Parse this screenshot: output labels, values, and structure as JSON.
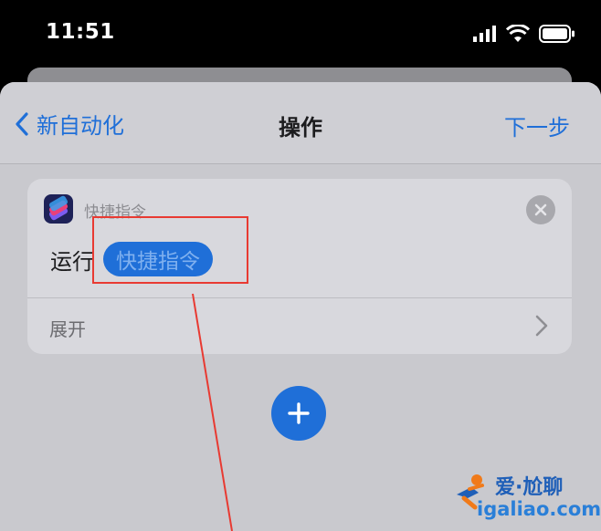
{
  "status_bar": {
    "time": "11:51"
  },
  "nav": {
    "back_label": "新自动化",
    "title": "操作",
    "next_label": "下一步"
  },
  "action_card": {
    "app_name": "快捷指令",
    "run_label": "运行",
    "shortcut_token": "快捷指令",
    "expand_label": "展开"
  },
  "watermark": {
    "brand": "爱·尬聊",
    "url": "igaliao.com"
  },
  "colors": {
    "accent": "#1f6fd8",
    "annotation": "#e83a32"
  },
  "icons": [
    "signal-icon",
    "wifi-icon",
    "battery-icon",
    "back-chevron-icon",
    "shortcuts-app-icon",
    "close-icon",
    "chevron-right-icon",
    "plus-icon"
  ]
}
